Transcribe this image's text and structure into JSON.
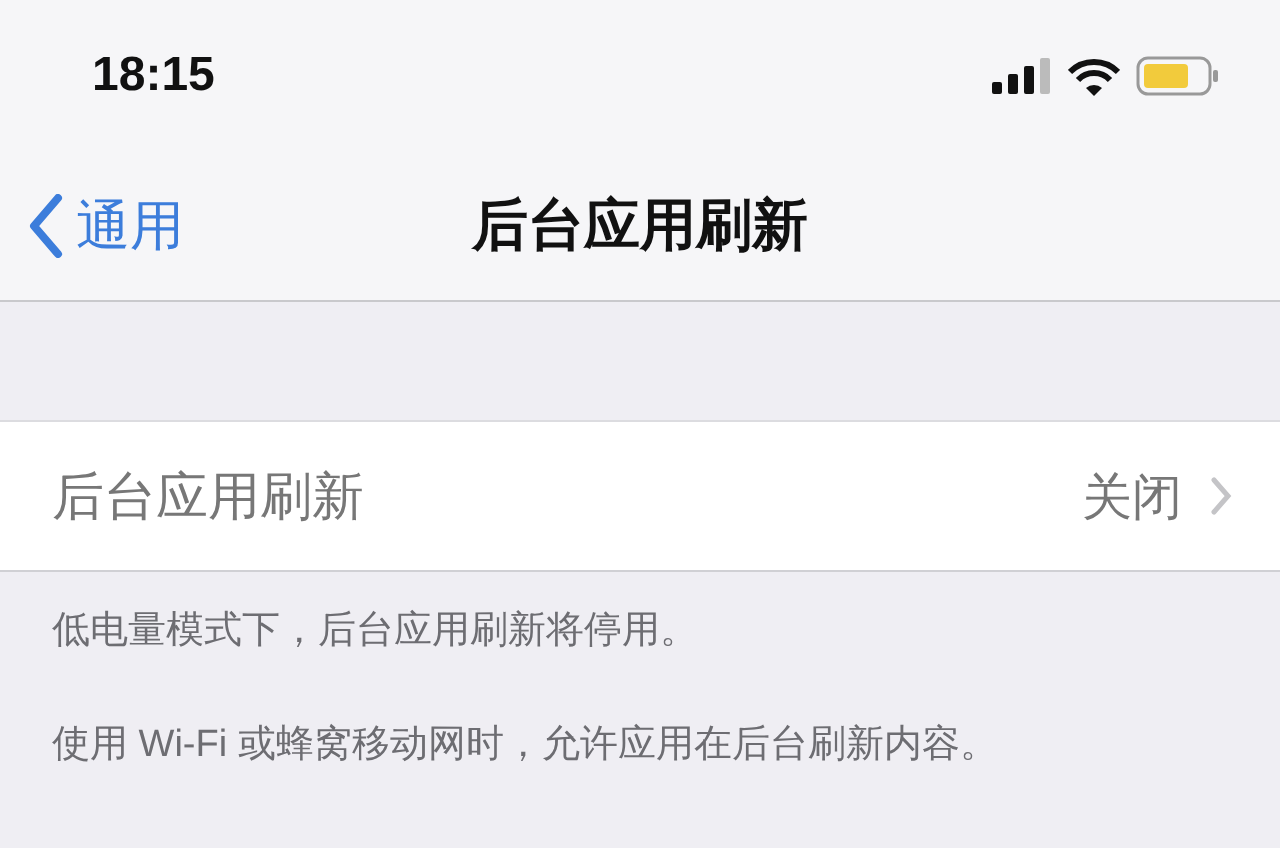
{
  "status_bar": {
    "time": "18:15"
  },
  "nav_bar": {
    "back": "通用",
    "title": "后台应用刷新"
  },
  "rows": [
    {
      "label": "后台应用刷新",
      "value": "关闭",
      "disabled": true
    }
  ],
  "footer_notes": [
    "低电量模式下，后台应用刷新将停用。",
    "使用 Wi-Fi 或蜂窝移动网时，允许应用在后台刷新内容。"
  ]
}
